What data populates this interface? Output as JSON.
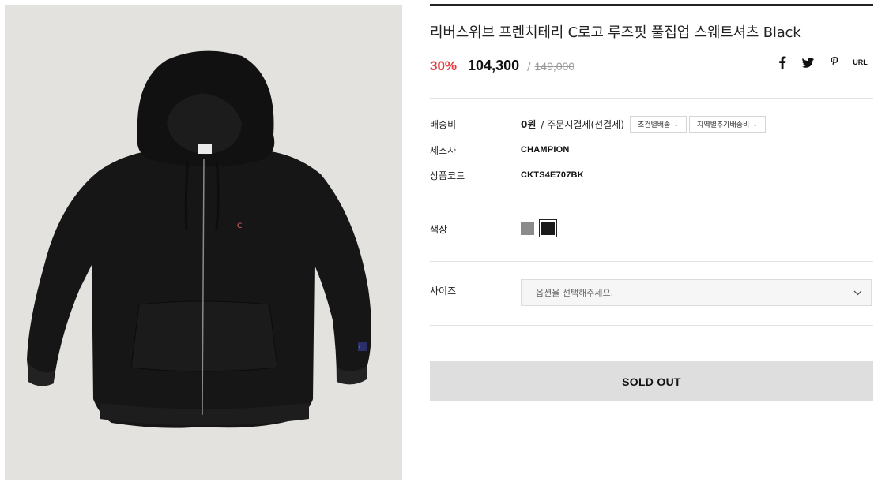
{
  "product": {
    "title": "리버스위브 프렌치테리 C로고 루즈핏 풀집업 스웨트셔츠 Black",
    "discount": "30%",
    "price": "104,300",
    "slash": "/",
    "original_price": "149,000"
  },
  "share": {
    "facebook_icon": "facebook-icon",
    "twitter_icon": "twitter-icon",
    "pinterest_icon": "pinterest-icon",
    "url_label": "URL"
  },
  "info": {
    "shipping_label": "배송비",
    "shipping_value": "0원",
    "shipping_method": "/ 주문시결제(선결제)",
    "shipping_chip_1": "조건별배송",
    "shipping_chip_2": "지역별추가배송비",
    "maker_label": "제조사",
    "maker_value": "CHAMPION",
    "code_label": "상품코드",
    "code_value": "CKTS4E707BK"
  },
  "color": {
    "label": "색상",
    "options": [
      {
        "name": "gray",
        "hex": "#8b8b8b"
      },
      {
        "name": "black",
        "hex": "#1a1a1a",
        "selected": true
      }
    ]
  },
  "size": {
    "label": "사이즈",
    "placeholder": "옵션을 선택해주세요."
  },
  "actions": {
    "soldout_label": "SOLD OUT"
  },
  "colors": {
    "accent_discount": "#e03c41",
    "photo_bg": "#e4e2de",
    "button_bg": "#dedede"
  }
}
